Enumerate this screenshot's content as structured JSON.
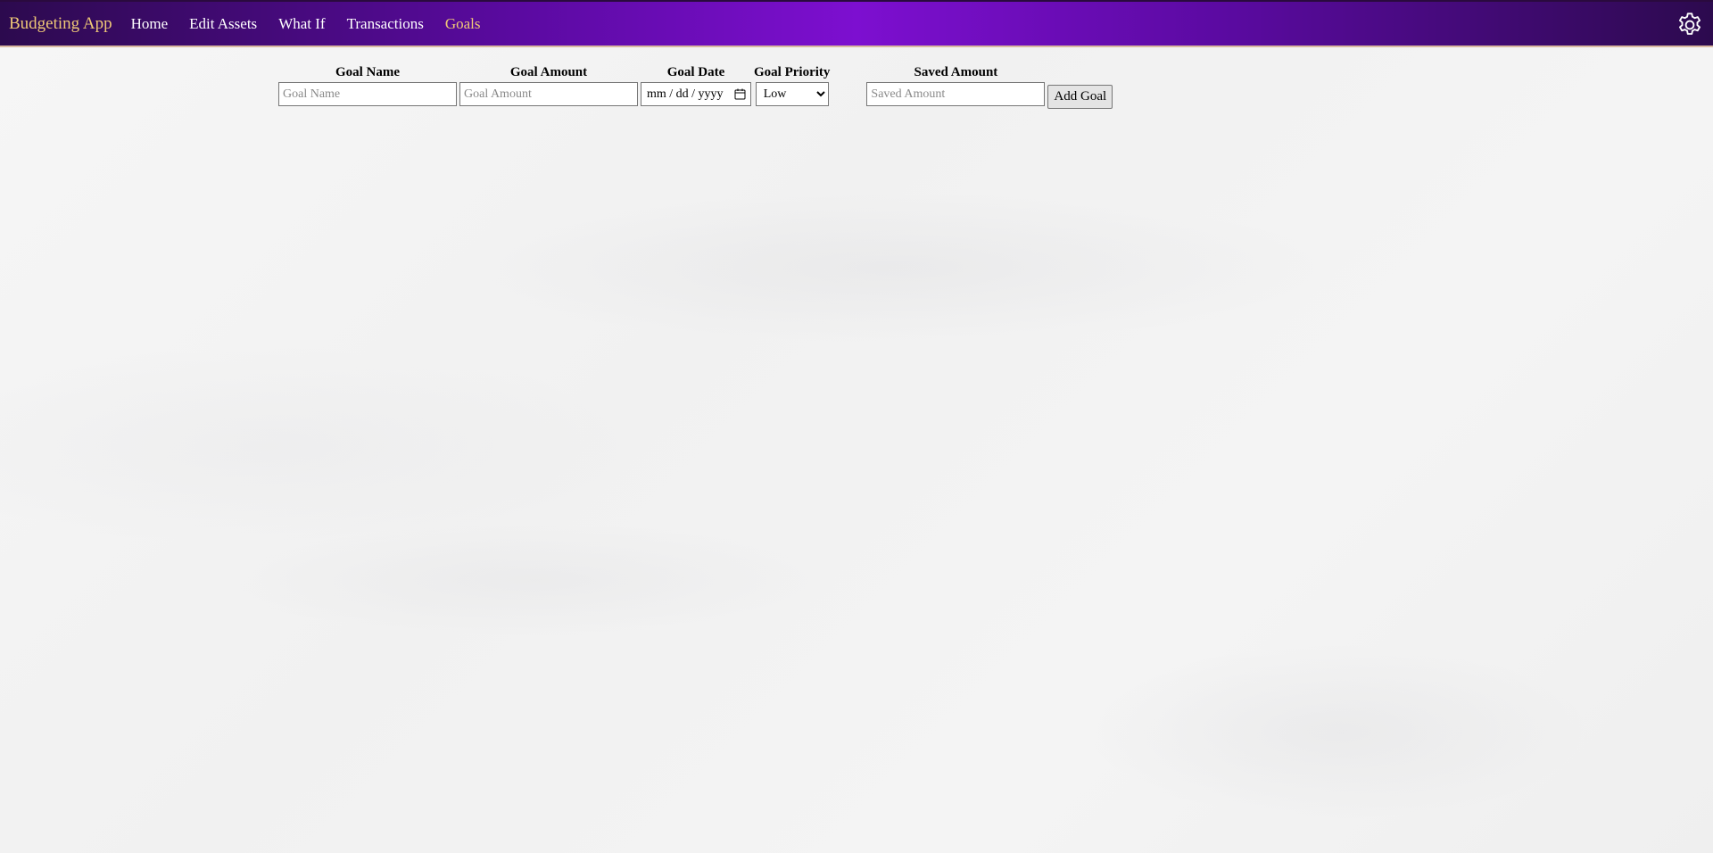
{
  "navbar": {
    "brand": "Budgeting App",
    "links": [
      "Home",
      "Edit Assets",
      "What If",
      "Transactions",
      "Goals"
    ],
    "active_link": "Goals",
    "settings_icon": "gear-icon",
    "colors": {
      "gradient_dark": "#2c0a4e",
      "gradient_bright": "#7d0fd0",
      "brand_color": "#f0c977"
    }
  },
  "goal_form": {
    "name": {
      "label": "Goal Name",
      "placeholder": "Goal Name"
    },
    "amount": {
      "label": "Goal Amount",
      "placeholder": "Goal Amount"
    },
    "date": {
      "label": "Goal Date",
      "value": "mm / dd / yyyy",
      "icon": "calendar-icon"
    },
    "priority": {
      "label": "Goal Priority",
      "selected": "Low"
    },
    "saved": {
      "label": "Saved Amount",
      "placeholder": "Saved Amount"
    },
    "submit_label": "Add Goal"
  }
}
